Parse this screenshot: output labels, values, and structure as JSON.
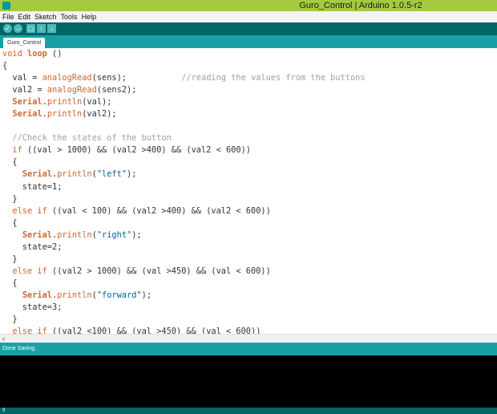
{
  "window": {
    "title": "Guro_Control | Arduino 1.0.5-r2"
  },
  "menu": [
    "File",
    "Edit",
    "Sketch",
    "Tools",
    "Help"
  ],
  "toolbar": {
    "verify": "✓",
    "upload": "→",
    "new": "▢",
    "open": "↑",
    "save": "↓"
  },
  "tab": {
    "label": "Guro_Control"
  },
  "status": {
    "message": "Done Saving."
  },
  "footer": {
    "line": "9"
  },
  "colors": {
    "teal_dark": "#006468",
    "teal": "#17a1a5",
    "title_green": "#a6c93f",
    "keyword": "#cc6633",
    "string": "#006699",
    "comment": "#95a5a6"
  },
  "code": {
    "l1a": "void",
    "l1b": "loop",
    "l1c": " ()",
    "l2": "{",
    "l3a": "  val = ",
    "l3b": "analogRead",
    "l3c": "(sens);           ",
    "l3d": "//reading the values from the buttons",
    "l4a": "  val2 = ",
    "l4b": "analogRead",
    "l4c": "(sens2);",
    "l5a": "Serial",
    "l5b": "println",
    "l5c": "(val);",
    "l6a": "Serial",
    "l6b": "println",
    "l6c": "(val2);",
    "l8": "  //Check the states of the button",
    "l9a": "if",
    "l9b": " ((val > 1000) && (val2 >400) && (val2 < 600))",
    "l10": "  {",
    "l11a": "Serial",
    "l11b": "println",
    "l11c": "(",
    "l11d": "\"left\"",
    "l11e": ");",
    "l12": "    state=1;",
    "l13": "  }",
    "l14a": "else",
    "l14b": "if",
    "l14c": " ((val < 100) && (val2 >400) && (val2 < 600))",
    "l15": "  {",
    "l16a": "Serial",
    "l16b": "println",
    "l16c": "(",
    "l16d": "\"right\"",
    "l16e": ");",
    "l17": "    state=2;",
    "l18": "  }",
    "l19a": "else",
    "l19b": "if",
    "l19c": " ((val2 > 1000) && (val >450) && (val < 600))",
    "l20": "  {",
    "l21a": "Serial",
    "l21b": "println",
    "l21c": "(",
    "l21d": "\"forward\"",
    "l21e": ");",
    "l22": "    state=3;",
    "l23": "  }",
    "l24a": "else",
    "l24b": "if",
    "l24c": " ((val2 <100) && (val >450) && (val < 600))"
  }
}
